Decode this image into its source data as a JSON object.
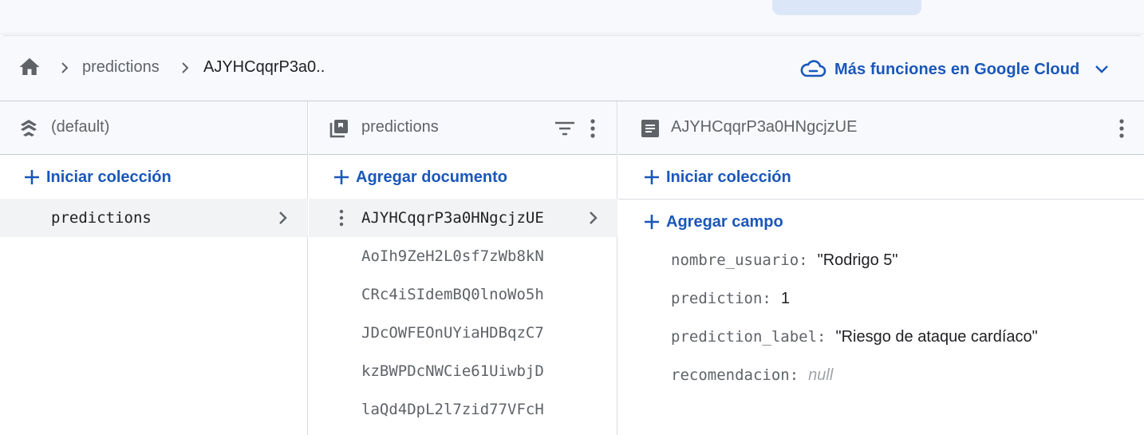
{
  "breadcrumb": {
    "items": [
      "predictions",
      "AJYHCqqrP3a0.."
    ]
  },
  "gcloud": {
    "label": "Más funciones en Google Cloud"
  },
  "panels": {
    "database": {
      "title": "(default)",
      "add_label": "Iniciar colección",
      "collections": [
        "predictions"
      ]
    },
    "collection": {
      "title": "predictions",
      "add_label": "Agregar documento",
      "documents": [
        "AJYHCqqrP3a0HNgcjzUE",
        "AoIh9ZeH2L0sf7zWb8kN",
        "CRc4iSIdemBQ0lnoWo5h",
        "JDcOWFEOnUYiaHDBqzC7",
        "kzBWPDcNWCie61UiwbjD",
        "laQd4DpL2l7zid77VFcH"
      ]
    },
    "document": {
      "title": "AJYHCqqrP3a0HNgcjzUE",
      "add_collection_label": "Iniciar colección",
      "add_field_label": "Agregar campo",
      "fields": [
        {
          "name": "nombre_usuario",
          "value": "\"Rodrigo 5\""
        },
        {
          "name": "prediction",
          "value": "1"
        },
        {
          "name": "prediction_label",
          "value": "\"Riesgo de ataque cardíaco\""
        },
        {
          "name": "recomendacion",
          "value": "null"
        }
      ]
    }
  },
  "colors": {
    "accent": "#1a57b9",
    "selected_bg": "#f1f3f4",
    "header_bg": "#f8f9fd"
  }
}
